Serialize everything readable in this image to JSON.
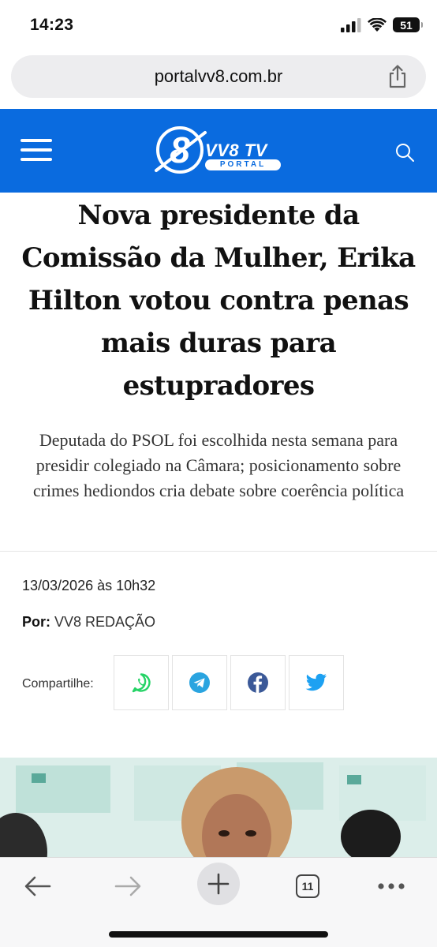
{
  "status_bar": {
    "time": "14:23",
    "battery": "51",
    "icons": [
      "signal-icon",
      "wifi-icon",
      "battery-icon"
    ]
  },
  "browser": {
    "url": "portalvv8.com.br",
    "toolbar": {
      "tab_count": "11",
      "icons": [
        "back-arrow-icon",
        "forward-arrow-icon",
        "plus-icon",
        "tabs-icon",
        "more-icon"
      ]
    }
  },
  "site": {
    "logo": {
      "mark": "8",
      "title": "VV8 TV",
      "subtitle": "PORTAL"
    },
    "header_color": "#0a6bdf"
  },
  "article": {
    "headline": "Nova presidente da Comissão da Mulher, Erika Hilton votou contra penas mais duras para estupradores",
    "subheadline": "Deputada do PSOL foi escolhida nesta semana para presidir colegiado na Câmara; posicionamento sobre crimes hediondos cria debate sobre coerência política",
    "date": "13/03/2026 às 10h32",
    "byline_label": "Por:",
    "author": "VV8 REDAÇÃO",
    "share_label": "Compartilhe:",
    "share_buttons": [
      {
        "name": "whatsapp",
        "icon": "whatsapp-icon",
        "color": "#25d366"
      },
      {
        "name": "telegram",
        "icon": "telegram-icon",
        "color": "#2aa4e0"
      },
      {
        "name": "facebook",
        "icon": "facebook-icon",
        "color": "#3b5998"
      },
      {
        "name": "twitter",
        "icon": "twitter-icon",
        "color": "#1da1f2"
      }
    ]
  }
}
